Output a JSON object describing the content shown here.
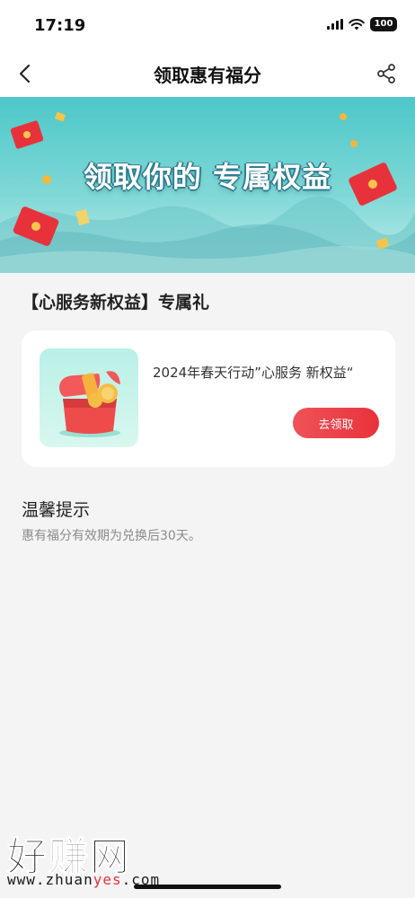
{
  "status_bar": {
    "time": "17:19",
    "battery": "100",
    "icons": [
      "signal-icon",
      "wifi-icon",
      "battery-icon"
    ]
  },
  "nav": {
    "title": "领取惠有福分",
    "back_icon": "back-chevron-icon",
    "share_icon": "share-icon"
  },
  "banner": {
    "title": "领取你的 专属权益"
  },
  "section": {
    "title": "【心服务新权益】专属礼"
  },
  "card": {
    "text": "2024年春天行动”心服务 新权益“",
    "button_label": "去领取",
    "image_icon": "gift-box-icon"
  },
  "tips": {
    "title": "温馨提示",
    "text": "惠有福分有效期为兑换后30天。"
  },
  "watermark": {
    "main": "好赚网",
    "url_prefix": "www.zhuan",
    "url_accent": "yes",
    "url_suffix": ".com"
  },
  "colors": {
    "accent": "#e8323b",
    "banner": "#4cc7c8",
    "background": "#f4f4f5"
  }
}
